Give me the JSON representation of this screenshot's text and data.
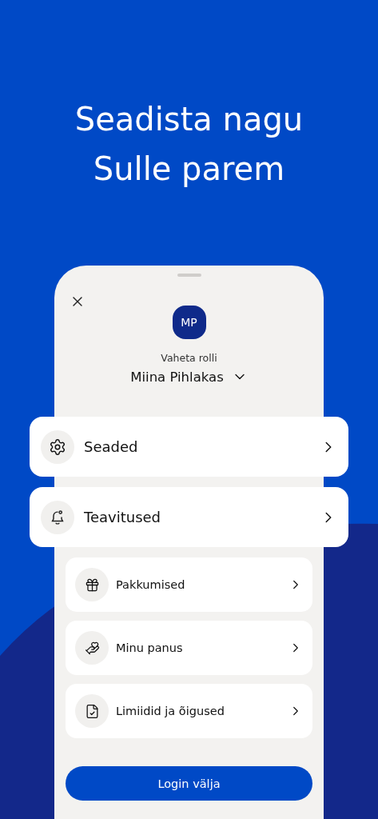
{
  "headline": [
    "Seadista nagu",
    "Sulle parem"
  ],
  "profile": {
    "initials": "MP",
    "switch_label": "Vaheta rolli",
    "name": "Miina Pihlakas"
  },
  "menu": [
    {
      "label": "Seaded",
      "kind": "highlighted"
    },
    {
      "label": "Teavitused",
      "kind": "highlighted"
    },
    {
      "label": "Pakkumised",
      "kind": "regular"
    },
    {
      "label": "Minu panus",
      "kind": "regular"
    },
    {
      "label": "Limiidid ja õigused",
      "kind": "regular"
    }
  ],
  "logout_button": "Login välja"
}
